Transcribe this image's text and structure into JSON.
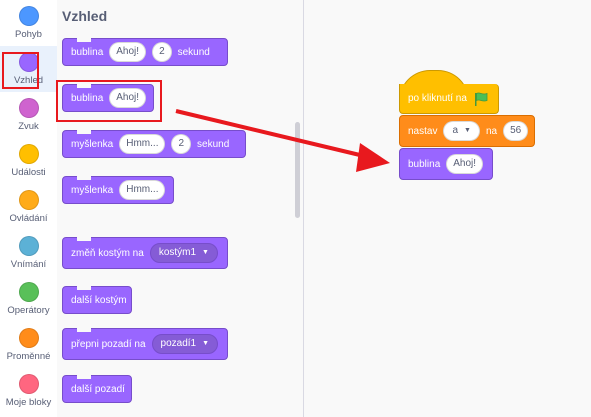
{
  "categories": [
    {
      "label": "Pohyb",
      "color": "#4c97ff",
      "selected": false
    },
    {
      "label": "Vzhled",
      "color": "#9966ff",
      "selected": true
    },
    {
      "label": "Zvuk",
      "color": "#cf63cf",
      "selected": false
    },
    {
      "label": "Události",
      "color": "#ffbf00",
      "selected": false
    },
    {
      "label": "Ovládání",
      "color": "#ffab19",
      "selected": false
    },
    {
      "label": "Vnímání",
      "color": "#5cb1d6",
      "selected": false
    },
    {
      "label": "Operátory",
      "color": "#59c059",
      "selected": false
    },
    {
      "label": "Proměnné",
      "color": "#ff8c1a",
      "selected": false
    },
    {
      "label": "Moje bloky",
      "color": "#ff6680",
      "selected": false
    }
  ],
  "palette": {
    "title": "Vzhled",
    "blocks": [
      {
        "text": "bublina",
        "input1": "Ahoj!",
        "input2": "2",
        "tail": "sekund"
      },
      {
        "text": "bublina",
        "input1": "Ahoj!"
      },
      {
        "text": "myšlenka",
        "input1": "Hmm...",
        "input2": "2",
        "tail": "sekund"
      },
      {
        "text": "myšlenka",
        "input1": "Hmm..."
      },
      {
        "text": "změň kostým na",
        "dropdown": "kostým1"
      },
      {
        "text": "další kostým"
      },
      {
        "text": "přepni pozadí na",
        "dropdown": "pozadí1"
      },
      {
        "text": "další pozadí"
      }
    ]
  },
  "canvas": {
    "hat_text": "po kliknutí na",
    "flag_icon": "green-flag-icon",
    "set_text": "nastav",
    "set_var": "a",
    "set_to": "na",
    "set_value": "56",
    "say_text": "bublina",
    "say_value": "Ahoj!"
  },
  "colors": {
    "looks": "#9966ff",
    "events": "#ffbf00",
    "variables": "#ff8c1a",
    "highlight": "#e8191e"
  }
}
